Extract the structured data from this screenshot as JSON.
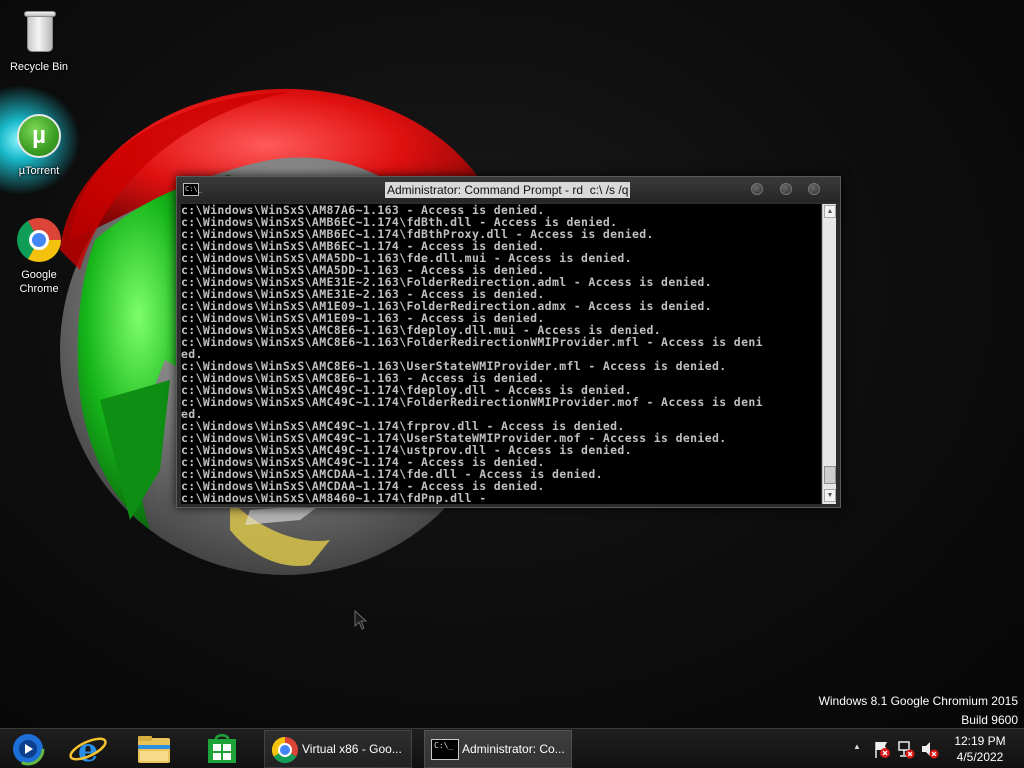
{
  "desktop": {
    "icons": [
      {
        "label": "Recycle Bin"
      },
      {
        "label": "µTorrent",
        "glyph": "µ"
      },
      {
        "label": "Google\nChrome"
      }
    ],
    "watermark": {
      "line1": "Windows 8.1 Google Chromium 2015",
      "line2": "Build 9600"
    }
  },
  "cmd": {
    "title": "Administrator: Command Prompt - rd  c:\\ /s /q",
    "icon_text": "C:\\_",
    "lines": [
      "c:\\Windows\\WinSxS\\AM87A6~1.163 - Access is denied.",
      "c:\\Windows\\WinSxS\\AMB6EC~1.174\\fdBth.dll - Access is denied.",
      "c:\\Windows\\WinSxS\\AMB6EC~1.174\\fdBthProxy.dll - Access is denied.",
      "c:\\Windows\\WinSxS\\AMB6EC~1.174 - Access is denied.",
      "c:\\Windows\\WinSxS\\AMA5DD~1.163\\fde.dll.mui - Access is denied.",
      "c:\\Windows\\WinSxS\\AMA5DD~1.163 - Access is denied.",
      "c:\\Windows\\WinSxS\\AME31E~2.163\\FolderRedirection.adml - Access is denied.",
      "c:\\Windows\\WinSxS\\AME31E~2.163 - Access is denied.",
      "c:\\Windows\\WinSxS\\AM1E09~1.163\\FolderRedirection.admx - Access is denied.",
      "c:\\Windows\\WinSxS\\AM1E09~1.163 - Access is denied.",
      "c:\\Windows\\WinSxS\\AMC8E6~1.163\\fdeploy.dll.mui - Access is denied.",
      "c:\\Windows\\WinSxS\\AMC8E6~1.163\\FolderRedirectionWMIProvider.mfl - Access is deni",
      "ed.",
      "c:\\Windows\\WinSxS\\AMC8E6~1.163\\UserStateWMIProvider.mfl - Access is denied.",
      "c:\\Windows\\WinSxS\\AMC8E6~1.163 - Access is denied.",
      "c:\\Windows\\WinSxS\\AMC49C~1.174\\fdeploy.dll - Access is denied.",
      "c:\\Windows\\WinSxS\\AMC49C~1.174\\FolderRedirectionWMIProvider.mof - Access is deni",
      "ed.",
      "c:\\Windows\\WinSxS\\AMC49C~1.174\\frprov.dll - Access is denied.",
      "c:\\Windows\\WinSxS\\AMC49C~1.174\\UserStateWMIProvider.mof - Access is denied.",
      "c:\\Windows\\WinSxS\\AMC49C~1.174\\ustprov.dll - Access is denied.",
      "c:\\Windows\\WinSxS\\AMC49C~1.174 - Access is denied.",
      "c:\\Windows\\WinSxS\\AMCDAA~1.174\\fde.dll - Access is denied.",
      "c:\\Windows\\WinSxS\\AMCDAA~1.174 - Access is denied.",
      "c:\\Windows\\WinSxS\\AM8460~1.174\\fdPnp.dll -"
    ],
    "scroll_up": "▲",
    "scroll_down": "▼"
  },
  "taskbar": {
    "pinned": [
      "media-center-icon",
      "internet-explorer-icon",
      "file-explorer-icon",
      "store-icon"
    ],
    "ie_glyph": "e",
    "tasks": [
      {
        "label": "Virtual x86 - Goo..."
      },
      {
        "label": "Administrator: Co..."
      }
    ],
    "cmd_task_glyph": "C:\\_",
    "tray_expand": "▲",
    "clock": {
      "time": "12:19 PM",
      "date": "4/5/2022"
    }
  },
  "colors": {
    "console_bg": "#000000",
    "console_text": "#c0c0c0",
    "chrome_red": "#db4437",
    "chrome_yellow": "#f4c20d",
    "chrome_green": "#0f9d58",
    "chrome_blue": "#4285f4"
  }
}
